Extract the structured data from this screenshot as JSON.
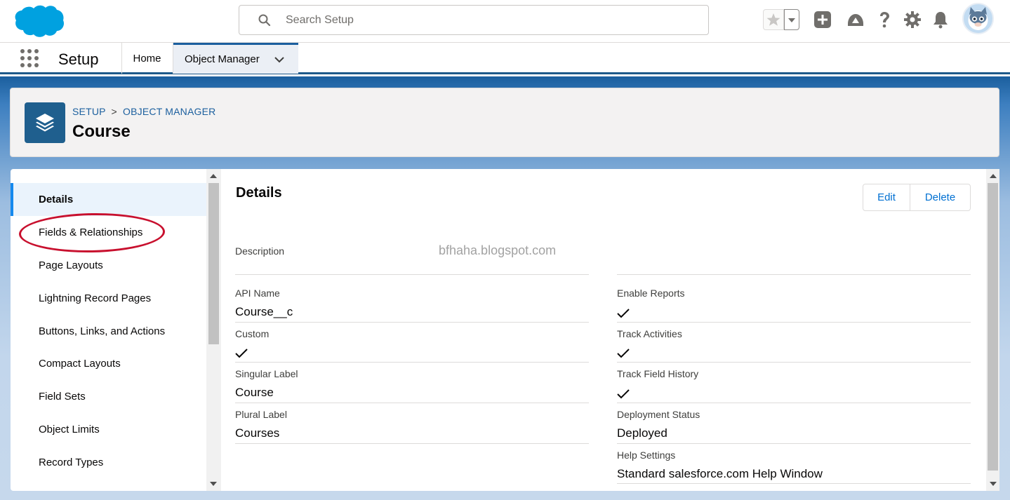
{
  "header": {
    "search_placeholder": "Search Setup",
    "icons": [
      "salesforce-logo",
      "search-icon",
      "star-icon",
      "chevron-down-icon",
      "add-icon",
      "trailhead-icon",
      "help-icon",
      "gear-icon",
      "bell-icon",
      "avatar"
    ]
  },
  "context_bar": {
    "app_name": "Setup",
    "tabs": [
      {
        "label": "Home"
      },
      {
        "label": "Object Manager",
        "active": true
      }
    ]
  },
  "page_header": {
    "breadcrumb_setup": "SETUP",
    "breadcrumb_sep": ">",
    "breadcrumb_om": "OBJECT MANAGER",
    "title": "Course"
  },
  "left_nav": {
    "items": [
      {
        "label": "Details",
        "active": true
      },
      {
        "label": "Fields & Relationships"
      },
      {
        "label": "Page Layouts"
      },
      {
        "label": "Lightning Record Pages"
      },
      {
        "label": "Buttons, Links, and Actions"
      },
      {
        "label": "Compact Layouts"
      },
      {
        "label": "Field Sets"
      },
      {
        "label": "Object Limits"
      },
      {
        "label": "Record Types"
      }
    ]
  },
  "details": {
    "title": "Details",
    "edit_label": "Edit",
    "delete_label": "Delete",
    "watermark": "bfhaha.blogspot.com",
    "left_fields": [
      {
        "label": "Description",
        "value": ""
      },
      {
        "label": "API Name",
        "value": "Course__c"
      },
      {
        "label": "Custom",
        "value": "✓"
      },
      {
        "label": "Singular Label",
        "value": "Course"
      },
      {
        "label": "Plural Label",
        "value": "Courses"
      }
    ],
    "right_fields": [
      {
        "label": "",
        "value": ""
      },
      {
        "label": "Enable Reports",
        "value": "✓"
      },
      {
        "label": "Track Activities",
        "value": "✓"
      },
      {
        "label": "Track Field History",
        "value": "✓"
      },
      {
        "label": "Deployment Status",
        "value": "Deployed"
      },
      {
        "label": "Help Settings",
        "value": "Standard salesforce.com Help Window"
      }
    ]
  },
  "colors": {
    "brand_blue": "#1b5f9e",
    "link_blue": "#0070d2",
    "annotation_red": "#c8102e",
    "active_nav_bg": "#eaf3fc"
  }
}
